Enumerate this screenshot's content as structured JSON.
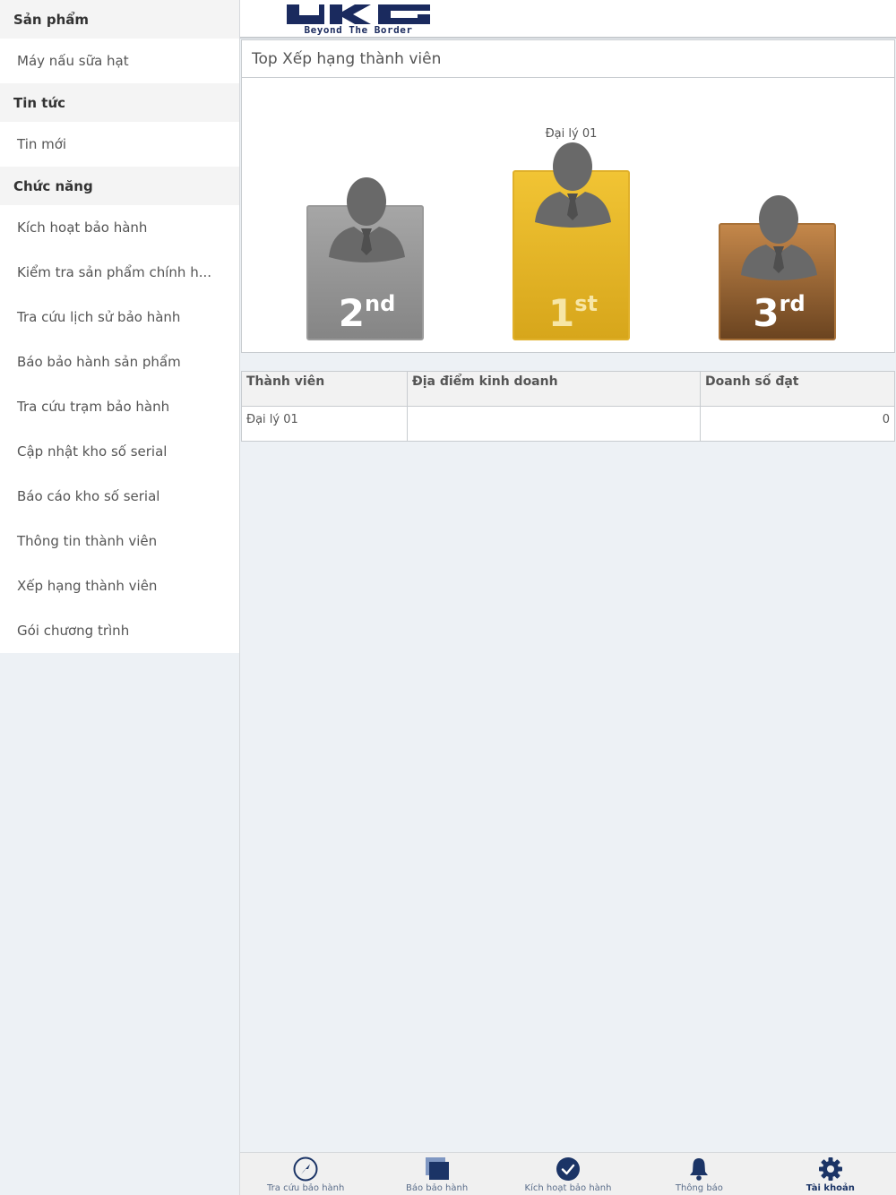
{
  "sidebar": {
    "sections": [
      {
        "title": "Sản phẩm",
        "items": [
          "Máy nấu sữa hạt"
        ]
      },
      {
        "title": "Tin tức",
        "items": [
          "Tin mới"
        ]
      },
      {
        "title": "Chức năng",
        "items": [
          "Kích hoạt bảo hành",
          "Kiểm tra sản phẩm chính h...",
          "Tra cứu lịch sử bảo hành",
          "Báo bảo hành sản phẩm",
          "Tra cứu trạm bảo hành",
          "Cập nhật kho số serial",
          "Báo cáo kho số serial",
          "Thông tin thành viên",
          "Xếp hạng thành viên",
          "Gói chương trình"
        ]
      }
    ]
  },
  "header": {
    "logo_text": "UKG",
    "logo_tagline": "Beyond The Border",
    "brand_color": "#1a2a5e"
  },
  "ranking": {
    "title": "Top Xếp hạng thành viên",
    "first": {
      "name": "Đại lý 01",
      "num": "1",
      "suffix": "st"
    },
    "second": {
      "num": "2",
      "suffix": "nd"
    },
    "third": {
      "num": "3",
      "suffix": "rd"
    }
  },
  "table": {
    "headers": [
      "Thành viên",
      "Địa điểm kinh doanh",
      "Doanh số đạt"
    ],
    "rows": [
      [
        "Đại lý 01",
        "",
        "0"
      ]
    ]
  },
  "bottom_nav": {
    "items": [
      {
        "label": "Tra cứu bảo hành",
        "icon": "compass-icon"
      },
      {
        "label": "Báo bảo hành",
        "icon": "stacked-squares-icon"
      },
      {
        "label": "Kích hoạt bảo hành",
        "icon": "check-circle-icon"
      },
      {
        "label": "Thông báo",
        "icon": "bell-icon"
      },
      {
        "label": "Tài khoản",
        "icon": "gear-icon",
        "active": true
      }
    ]
  }
}
